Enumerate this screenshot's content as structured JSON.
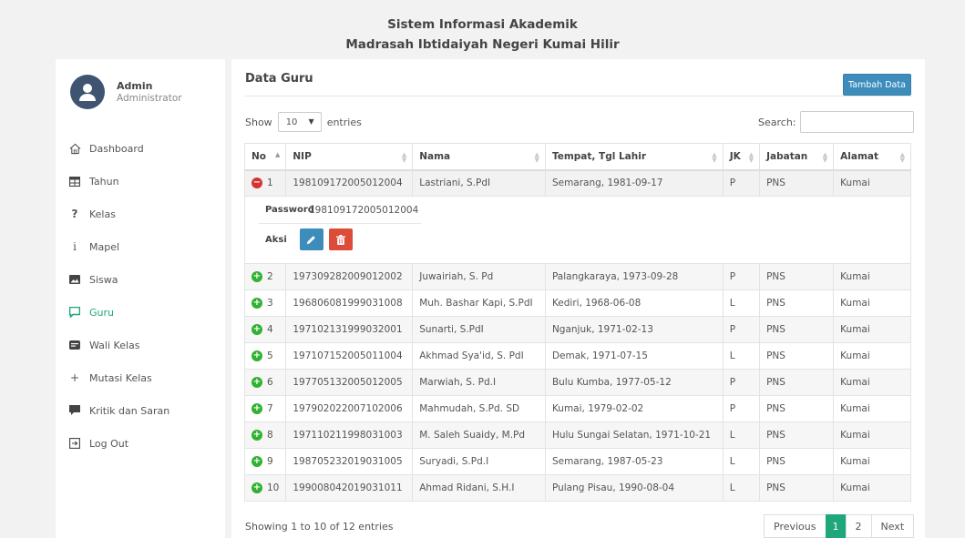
{
  "header": {
    "line1": "Sistem Informasi Akademik",
    "line2": "Madrasah Ibtidaiyah Negeri Kumai Hilir"
  },
  "profile": {
    "name": "Admin",
    "role": "Administrator",
    "icon": "user-avatar-icon"
  },
  "menu": [
    {
      "label": "Dashboard",
      "icon": "home-icon"
    },
    {
      "label": "Tahun",
      "icon": "table-icon"
    },
    {
      "label": "Kelas",
      "icon": "question-icon"
    },
    {
      "label": "Mapel",
      "icon": "info-icon"
    },
    {
      "label": "Siswa",
      "icon": "image-icon"
    },
    {
      "label": "Guru",
      "icon": "chat-icon",
      "active": true
    },
    {
      "label": "Wali Kelas",
      "icon": "message-icon"
    },
    {
      "label": "Mutasi Kelas",
      "icon": "plus-icon"
    },
    {
      "label": "Kritik dan Saran",
      "icon": "comment-icon"
    },
    {
      "label": "Log Out",
      "icon": "logout-icon"
    }
  ],
  "panel": {
    "title": "Data Guru",
    "add_button": "Tambah Data",
    "show_label": "Show",
    "entries_label": "entries",
    "page_length": "10",
    "search_label": "Search:",
    "search_value": ""
  },
  "table": {
    "columns": [
      "No",
      "NIP",
      "Nama",
      "Tempat, Tgl Lahir",
      "JK",
      "Jabatan",
      "Alamat"
    ],
    "rows": [
      {
        "no": "1",
        "nip": "198109172005012004",
        "nama": "Lastriani, S.PdI",
        "ttl": "Semarang, 1981-09-17",
        "jk": "P",
        "jabatan": "PNS",
        "alamat": "Kumai"
      },
      {
        "no": "2",
        "nip": "197309282009012002",
        "nama": "Juwairiah, S. Pd",
        "ttl": "Palangkaraya, 1973-09-28",
        "jk": "P",
        "jabatan": "PNS",
        "alamat": "Kumai"
      },
      {
        "no": "3",
        "nip": "196806081999031008",
        "nama": "Muh. Bashar Kapi, S.PdI",
        "ttl": "Kediri, 1968-06-08",
        "jk": "L",
        "jabatan": "PNS",
        "alamat": "Kumai"
      },
      {
        "no": "4",
        "nip": "197102131999032001",
        "nama": "Sunarti, S.PdI",
        "ttl": "Nganjuk, 1971-02-13",
        "jk": "P",
        "jabatan": "PNS",
        "alamat": "Kumai"
      },
      {
        "no": "5",
        "nip": "197107152005011004",
        "nama": "Akhmad Sya'id, S. PdI",
        "ttl": "Demak, 1971-07-15",
        "jk": "L",
        "jabatan": "PNS",
        "alamat": "Kumai"
      },
      {
        "no": "6",
        "nip": "197705132005012005",
        "nama": "Marwiah, S. Pd.I",
        "ttl": "Bulu Kumba, 1977-05-12",
        "jk": "P",
        "jabatan": "PNS",
        "alamat": "Kumai"
      },
      {
        "no": "7",
        "nip": "197902022007102006",
        "nama": "Mahmudah, S.Pd. SD",
        "ttl": "Kumai, 1979-02-02",
        "jk": "P",
        "jabatan": "PNS",
        "alamat": "Kumai"
      },
      {
        "no": "8",
        "nip": "197110211998031003",
        "nama": "M. Saleh Suaidy, M.Pd",
        "ttl": "Hulu Sungai Selatan, 1971-10-21",
        "jk": "L",
        "jabatan": "PNS",
        "alamat": "Kumai"
      },
      {
        "no": "9",
        "nip": "198705232019031005",
        "nama": "Suryadi, S.Pd.I",
        "ttl": "Semarang, 1987-05-23",
        "jk": "L",
        "jabatan": "PNS",
        "alamat": "Kumai"
      },
      {
        "no": "10",
        "nip": "199008042019031011",
        "nama": "Ahmad Ridani, S.H.I",
        "ttl": "Pulang Pisau, 1990-08-04",
        "jk": "L",
        "jabatan": "PNS",
        "alamat": "Kumai"
      }
    ],
    "detail": {
      "password_label": "Password",
      "password_value": "198109172005012004",
      "action_label": "Aksi"
    }
  },
  "footer": {
    "info": "Showing 1 to 10 of 12 entries",
    "previous": "Previous",
    "page1": "1",
    "page2": "2",
    "next": "Next"
  },
  "colors": {
    "accent": "#1fa67a",
    "primary": "#3c8dbc",
    "danger": "#dd4b39",
    "avatar": "#3e5470"
  }
}
